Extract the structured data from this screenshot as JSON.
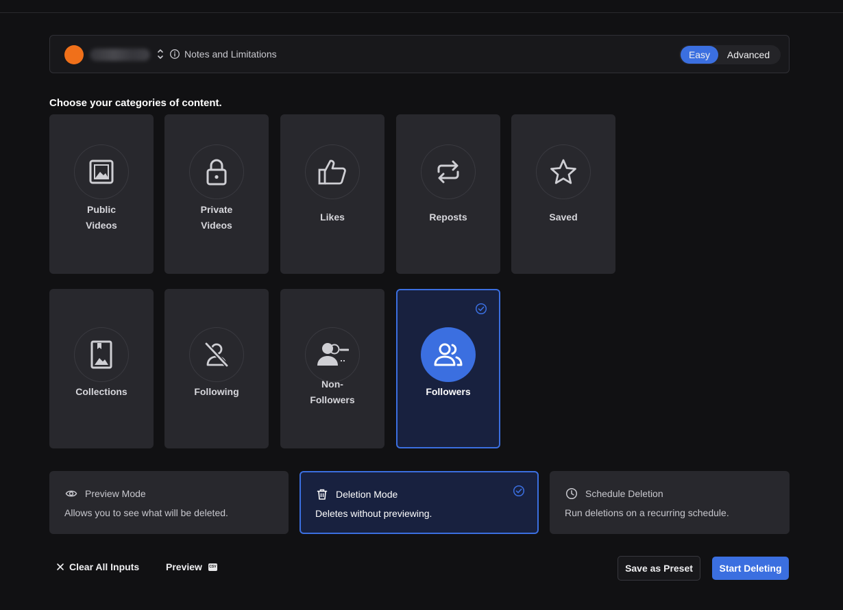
{
  "header": {
    "notes_label": "Notes and Limitations",
    "toggle": {
      "easy": "Easy",
      "advanced": "Advanced",
      "selected": "Easy"
    },
    "avatar_color": "#f0701a"
  },
  "section_title": "Choose your categories of content.",
  "categories": [
    {
      "label": "Public\nVideos",
      "icon": "image-icon",
      "selected": false
    },
    {
      "label": "Private\nVideos",
      "icon": "lock-icon",
      "selected": false
    },
    {
      "label": "Likes",
      "icon": "thumbs-up-icon",
      "selected": false
    },
    {
      "label": "Reposts",
      "icon": "repost-icon",
      "selected": false
    },
    {
      "label": "Saved",
      "icon": "star-icon",
      "selected": false
    },
    {
      "label": "Collections",
      "icon": "bookmark-image-icon",
      "selected": false
    },
    {
      "label": "Following",
      "icon": "user-off-icon",
      "selected": false
    },
    {
      "label": "Non-\nFollowers",
      "icon": "user-minus-icon",
      "selected": false
    },
    {
      "label": "Followers",
      "icon": "users-icon",
      "selected": true
    }
  ],
  "modes": [
    {
      "title": "Preview Mode",
      "desc": "Allows you to see what will be deleted.",
      "icon": "eye-icon",
      "selected": false
    },
    {
      "title": "Deletion Mode",
      "desc": "Deletes without previewing.",
      "icon": "trash-icon",
      "selected": true
    },
    {
      "title": "Schedule Deletion",
      "desc": "Run deletions on a recurring schedule.",
      "icon": "clock-icon",
      "selected": false
    }
  ],
  "footer": {
    "clear_label": "Clear All Inputs",
    "preview_label": "Preview",
    "preview_badge": "CSV",
    "save_label": "Save as Preset",
    "start_label": "Start Deleting"
  },
  "colors": {
    "accent": "#3b6fe0",
    "selected_bg": "#18213f",
    "card_bg": "#28282d",
    "page_bg": "#111113"
  }
}
